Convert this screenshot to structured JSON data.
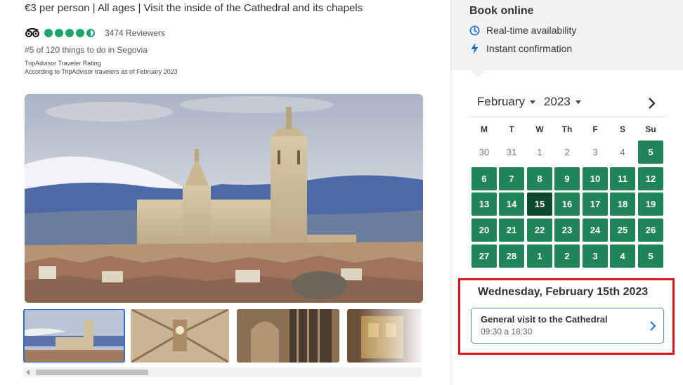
{
  "product": {
    "headline": "€3 per person | All ages | Visit the inside of the Cathedral and its chapels",
    "reviewers": "3474 Reviewers",
    "rank": "#5 of 120 things to do in Segovia",
    "rating_label": "TripAdvisor Traveler Rating",
    "rating_note": "According to TripAdvisor travelers as of February 2023",
    "rating_value": 4.5,
    "rating_max": 5
  },
  "gallery": {
    "thumb_count_visible": 4,
    "active_thumb": 1
  },
  "booking": {
    "title": "Book online",
    "features": [
      "Real-time availability",
      "Instant confirmation"
    ]
  },
  "calendar": {
    "month": "February",
    "year": "2023",
    "weekdays": [
      "M",
      "T",
      "W",
      "Th",
      "F",
      "S",
      "Su"
    ],
    "weeks": [
      [
        {
          "d": "30",
          "s": "out"
        },
        {
          "d": "31",
          "s": "out"
        },
        {
          "d": "1",
          "s": "out"
        },
        {
          "d": "2",
          "s": "out"
        },
        {
          "d": "3",
          "s": "out"
        },
        {
          "d": "4",
          "s": "out"
        },
        {
          "d": "5",
          "s": "av"
        }
      ],
      [
        {
          "d": "6",
          "s": "av"
        },
        {
          "d": "7",
          "s": "av"
        },
        {
          "d": "8",
          "s": "av"
        },
        {
          "d": "9",
          "s": "av"
        },
        {
          "d": "10",
          "s": "av"
        },
        {
          "d": "11",
          "s": "av"
        },
        {
          "d": "12",
          "s": "av"
        }
      ],
      [
        {
          "d": "13",
          "s": "av"
        },
        {
          "d": "14",
          "s": "av"
        },
        {
          "d": "15",
          "s": "sel"
        },
        {
          "d": "16",
          "s": "av"
        },
        {
          "d": "17",
          "s": "av"
        },
        {
          "d": "18",
          "s": "av"
        },
        {
          "d": "19",
          "s": "av"
        }
      ],
      [
        {
          "d": "20",
          "s": "av"
        },
        {
          "d": "21",
          "s": "av"
        },
        {
          "d": "22",
          "s": "av"
        },
        {
          "d": "23",
          "s": "av"
        },
        {
          "d": "24",
          "s": "av"
        },
        {
          "d": "25",
          "s": "av"
        },
        {
          "d": "26",
          "s": "av"
        }
      ],
      [
        {
          "d": "27",
          "s": "av"
        },
        {
          "d": "28",
          "s": "av"
        },
        {
          "d": "1",
          "s": "av"
        },
        {
          "d": "2",
          "s": "av"
        },
        {
          "d": "3",
          "s": "av"
        },
        {
          "d": "4",
          "s": "av"
        },
        {
          "d": "5",
          "s": "av"
        }
      ]
    ],
    "selected_date": "Wednesday, February 15th 2023"
  },
  "session": {
    "name": "General visit to the Cathedral",
    "time": "09:30 a 18:30"
  },
  "colors": {
    "available": "#21855a",
    "selected": "#0e4a2e",
    "rating_green": "#1aa56a",
    "highlight_red": "#e0131b",
    "link_blue": "#2a6fd6"
  }
}
